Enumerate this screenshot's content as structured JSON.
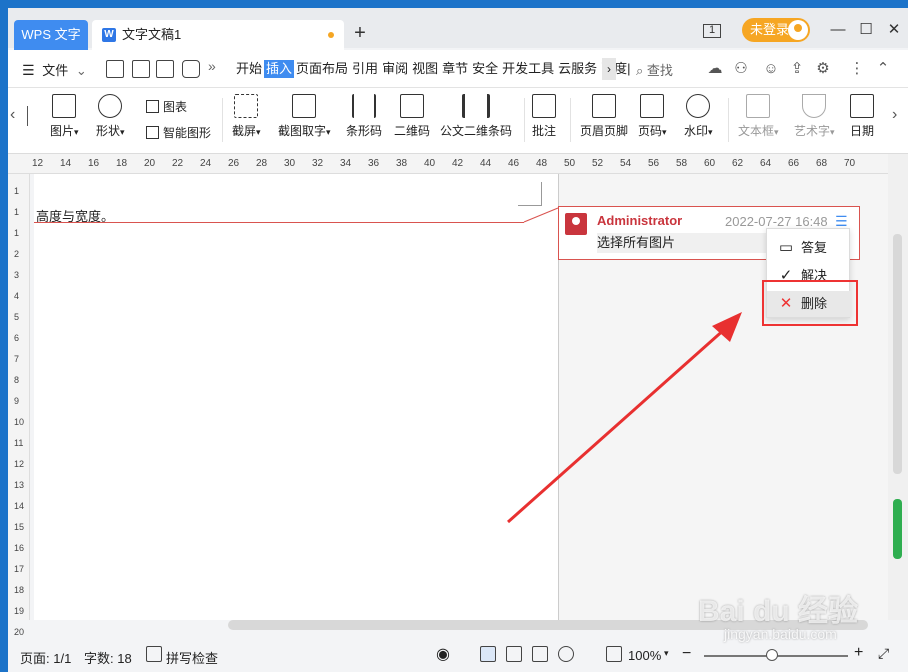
{
  "titlebar": {
    "app_tab": "WPS 文字",
    "doc_tab_title": "文字文稿1",
    "doc_icon_letter": "W",
    "new_tab": "+",
    "login_label": "未登录",
    "window_layout_label": "1",
    "minimize": "—",
    "maximize": "☐",
    "close": "✕"
  },
  "menubar": {
    "file_label": "文件",
    "more_glyph": "»",
    "tabs": [
      "开始",
      "插入",
      "页面布局",
      "引用",
      "审阅",
      "视图",
      "章节",
      "安全",
      "开发工具",
      "云服务",
      "百度|"
    ],
    "active_tab": "插入",
    "search_label": "查找"
  },
  "ribbon": {
    "items": {
      "picture": "图片",
      "shape": "形状",
      "chart": "图表",
      "smart_art": "智能图形",
      "screenshot": "截屏",
      "screenshot_text": "截图取字",
      "barcode": "条形码",
      "qrcode": "二维码",
      "official_barcode": "公文二维条码",
      "comment": "批注",
      "header_footer": "页眉页脚",
      "page_number": "页码",
      "watermark": "水印",
      "textbox": "文本框",
      "wordart": "艺术字",
      "date": "日期"
    }
  },
  "ruler": {
    "h_numbers": [
      "12",
      "14",
      "16",
      "18",
      "20",
      "22",
      "24",
      "26",
      "28",
      "30",
      "32",
      "34",
      "36",
      "38",
      "40",
      "42",
      "44",
      "46",
      "48",
      "50",
      "52",
      "54",
      "56",
      "58",
      "60",
      "62",
      "64",
      "66",
      "68",
      "70"
    ],
    "v_numbers": [
      "1",
      "1",
      "1",
      "2",
      "3",
      "4",
      "5",
      "6",
      "7",
      "8",
      "9",
      "10",
      "11",
      "12",
      "13",
      "14",
      "15",
      "16",
      "17",
      "18",
      "19",
      "20"
    ]
  },
  "document": {
    "text": "高度与宽度。"
  },
  "comment": {
    "author": "Administrator",
    "date": "2022-07-27 16:48",
    "body": "选择所有图片"
  },
  "context_menu": {
    "reply": "答复",
    "resolve": "解决",
    "delete": "删除"
  },
  "statusbar": {
    "page": "页面: 1/1",
    "word_count": "字数: 18",
    "spell_check": "拼写检查",
    "zoom": "100%",
    "zoom_minus": "−",
    "zoom_plus": "+"
  },
  "watermark": {
    "text": "Bai du 经验",
    "sub": "jingyan.baidu.com"
  },
  "colors": {
    "accent": "#3f8cf0",
    "comment_red": "#c9353d",
    "annotation_red": "#e83030",
    "login_orange": "#f6a623"
  }
}
